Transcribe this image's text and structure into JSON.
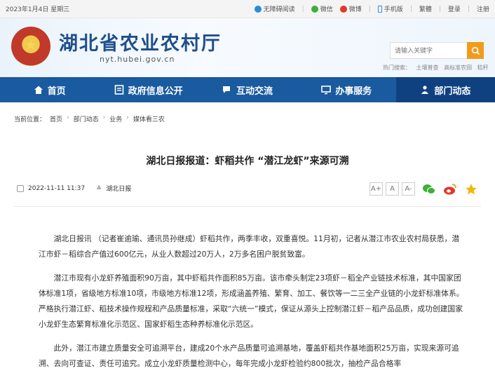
{
  "topbar": {
    "date": "2023年1月4日 星期三",
    "links": [
      "无障碍阅读",
      "微信",
      "微博",
      "手机版",
      "繁體",
      "登录",
      "注册"
    ]
  },
  "header": {
    "title": "湖北省农业农村厅",
    "url": "nyt.hubei.gov.cn",
    "search_placeholder": "请输入关键字",
    "hot_label": "热门搜索：",
    "hot_terms": [
      "土壤普查",
      "高标准农田",
      "秸秆"
    ]
  },
  "nav": [
    {
      "label": "首页"
    },
    {
      "label": "政府信息公开"
    },
    {
      "label": "互动交流"
    },
    {
      "label": "办事服务"
    },
    {
      "label": "部门动态"
    }
  ],
  "breadcrumb": {
    "label": "当前位置：",
    "items": [
      "首页",
      "部门动态",
      "业务",
      "媒体看三农"
    ]
  },
  "article": {
    "title": "湖北日报报道：虾稻共作 “潜江龙虾”来源可溯",
    "date": "2022-11-11 11:37",
    "source": "湖北日报",
    "font_buttons": [
      "A+",
      "A",
      "A-"
    ],
    "paragraphs": [
      "湖北日报讯 （记者崔逾瑜、通讯员孙继成）虾稻共作，两季丰收，双重喜悦。11月初，记者从潜江市农业农村局获悉，潜江市虾－稻综合产值过600亿元，从业人数超过20万人，2万多名困户脱贫致富。",
      "潜江市现有小龙虾养殖面积90万亩，其中虾稻共作面积85万亩。该市牵头制定23项虾－稻全产业链技术标准，其中国家团体标准1项，省级地方标准10项，市级地方标准12项，形成涵盖养殖、繁育、加工、餐饮等一二三全产业链的小龙虾标准体系。严格执行潜江虾、稻技术操作规程和产品质量标准，采取“六统一”模式，保证从源头上控制潜江虾－稻产品品质，成功创建国家小龙虾生态繁育标准化示范区、国家虾稻生态种养标准化示范区。",
      "此外，潜江市建立质量安全可追溯平台，建成20个水产品质量可追溯基地，覆盖虾稻共作基地面积25万亩，实现来源可追溯、去向可查证、责任可追究。成立小龙虾质量检测中心，每年完成小龙虾检验约800批次，抽检产品合格率"
    ]
  },
  "colors": {
    "nav_bg": "#1a5a9e",
    "nav_active": "#0f4180",
    "title_blue": "#1f4f8c",
    "search_btn": "#f29b1a"
  }
}
